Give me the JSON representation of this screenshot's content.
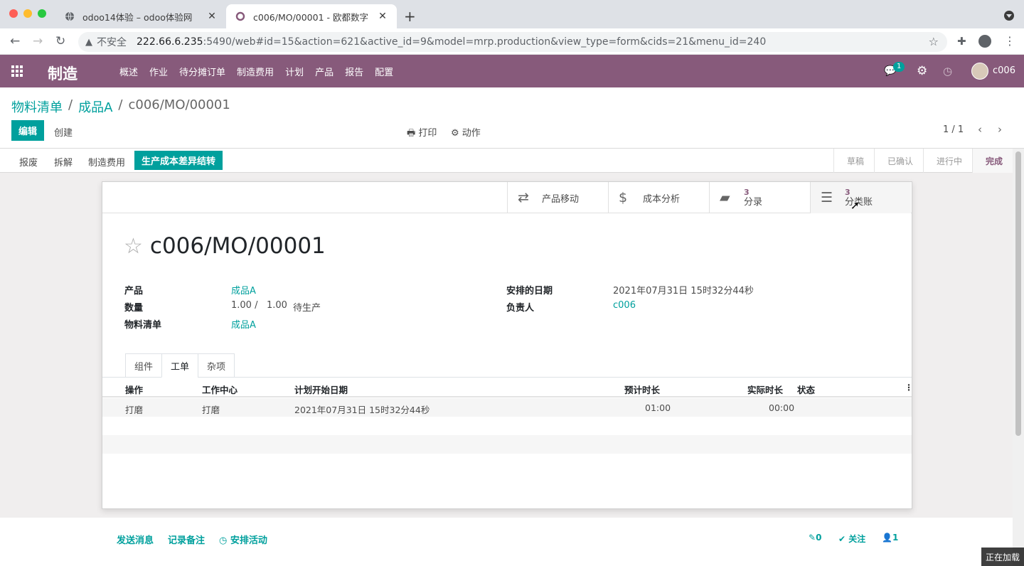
{
  "browser": {
    "tabs": [
      {
        "title": "odoo14体验 – odoo体验网"
      },
      {
        "title": "c006/MO/00001 - 欧都数字"
      }
    ],
    "security_label": "不安全",
    "url_host": "222.66.6.235",
    "url_rest": ":5490/web#id=15&action=621&active_id=9&model=mrp.production&view_type=form&cids=21&menu_id=240"
  },
  "navbar": {
    "brand": "制造",
    "menus": [
      "概述",
      "作业",
      "待分摊订单",
      "制造费用",
      "计划",
      "产品",
      "报告",
      "配置"
    ],
    "chat_count": "1",
    "user": "c006"
  },
  "breadcrumb": {
    "items": [
      "物料清单",
      "成品A"
    ],
    "current": "c006/MO/00001",
    "sep": "/"
  },
  "controls": {
    "edit": "编辑",
    "create": "创建",
    "print": "打印",
    "action": "动作",
    "pager": "1 / 1"
  },
  "statusbar": {
    "buttons": [
      "报废",
      "拆解",
      "制造费用"
    ],
    "primary": "生产成本差异结转",
    "stages": [
      "草稿",
      "已确认",
      "进行中",
      "完成"
    ]
  },
  "smart_buttons": [
    {
      "label": "产品移动",
      "icon": "arrows-icon"
    },
    {
      "label": "成本分析",
      "icon": "dollar-icon"
    },
    {
      "label": "分录",
      "count": "3",
      "icon": "book-icon"
    },
    {
      "label": "分类账",
      "count": "3",
      "icon": "list-icon"
    }
  ],
  "record": {
    "title": "c006/MO/00001",
    "product_label": "产品",
    "product_value": "成品A",
    "qty_label": "数量",
    "qty_value": "1.00 /",
    "qty_total": "1.00",
    "qty_state": "待生产",
    "bom_label": "物料清单",
    "bom_value": "成品A",
    "date_label": "安排的日期",
    "date_value": "2021年07月31日 15时32分44秒",
    "user_label": "负责人",
    "user_value": "c006"
  },
  "tabs": [
    "组件",
    "工单",
    "杂项"
  ],
  "workorders": {
    "headers": [
      "操作",
      "工作中心",
      "计划开始日期",
      "预计时长",
      "实际时长",
      "状态"
    ],
    "rows": [
      {
        "op": "打磨",
        "center": "打磨",
        "start": "2021年07月31日 15时32分44秒",
        "expected": "01:00",
        "actual": "00:00",
        "state": ""
      }
    ]
  },
  "chatter": {
    "send": "发送消息",
    "note": "记录备注",
    "activity": "安排活动",
    "attachments": "0",
    "follow": "关注",
    "followers": "1"
  },
  "loading": "正在加载"
}
